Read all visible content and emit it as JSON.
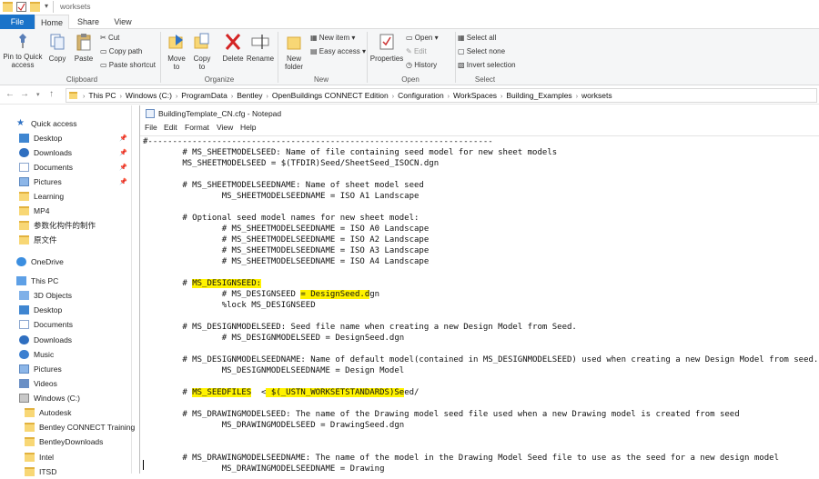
{
  "window": {
    "title": "worksets"
  },
  "tabs": {
    "file": "File",
    "home": "Home",
    "share": "Share",
    "view": "View"
  },
  "ribbon": {
    "clipboard": {
      "pin": "Pin to Quick access",
      "copy": "Copy",
      "paste": "Paste",
      "cut": "Cut",
      "copy_path": "Copy path",
      "paste_shortcut": "Paste shortcut",
      "label": "Clipboard"
    },
    "organize": {
      "move": "Move to",
      "copy_to": "Copy to",
      "delete": "Delete",
      "rename": "Rename",
      "label": "Organize"
    },
    "new": {
      "new_folder": "New folder",
      "new_item": "New item",
      "easy_access": "Easy access",
      "label": "New"
    },
    "open": {
      "properties": "Properties",
      "open": "Open",
      "edit": "Edit",
      "history": "History",
      "label": "Open"
    },
    "select": {
      "select_all": "Select all",
      "select_none": "Select none",
      "invert": "Invert selection",
      "label": "Select"
    }
  },
  "address": {
    "crumbs": [
      "This PC",
      "Windows (C:)",
      "ProgramData",
      "Bentley",
      "OpenBuildings CONNECT Edition",
      "Configuration",
      "WorkSpaces",
      "Building_Examples",
      "worksets"
    ]
  },
  "nav": {
    "quick_access": "Quick access",
    "quick": [
      {
        "label": "Desktop",
        "pinned": true
      },
      {
        "label": "Downloads",
        "pinned": true
      },
      {
        "label": "Documents",
        "pinned": true
      },
      {
        "label": "Pictures",
        "pinned": true
      },
      {
        "label": "Learning",
        "pinned": false
      },
      {
        "label": "MP4",
        "pinned": false
      },
      {
        "label": "参数化构件的制作",
        "pinned": false
      },
      {
        "label": "原文件",
        "pinned": false
      }
    ],
    "onedrive": "OneDrive",
    "this_pc": "This PC",
    "pc_items": [
      "3D Objects",
      "Desktop",
      "Documents",
      "Downloads",
      "Music",
      "Pictures",
      "Videos",
      "Windows (C:)"
    ],
    "drive_items": [
      "Autodesk",
      "Bentley CONNECT Training",
      "BentleyDownloads",
      "Intel",
      "ITSD"
    ]
  },
  "notepad": {
    "title": "BuildingTemplate_CN.cfg - Notepad",
    "menu": [
      "File",
      "Edit",
      "Format",
      "View",
      "Help"
    ],
    "lines": [
      "#----------------------------------------------------------------------",
      "        # MS_SHEETMODELSEED: Name of file containing seed model for new sheet models",
      "        MS_SHEETMODELSEED = $(TFDIR)Seed/SheetSeed_ISOCN.dgn",
      "",
      "        # MS_SHEETMODELSEEDNAME: Name of sheet model seed",
      "                MS_SHEETMODELSEEDNAME = ISO A1 Landscape",
      "",
      "        # Optional seed model names for new sheet model:",
      "                # MS_SHEETMODELSEEDNAME = ISO A0 Landscape",
      "                # MS_SHEETMODELSEEDNAME = ISO A2 Landscape",
      "                # MS_SHEETMODELSEEDNAME = ISO A3 Landscape",
      "                # MS_SHEETMODELSEEDNAME = ISO A4 Landscape",
      "",
      "        # MS_DESIGNSEED:",
      "                # MS_DESIGNSEED = DesignSeed.dgn",
      "                %lock MS_DESIGNSEED",
      "",
      "        # MS_DESIGNMODELSEED: Seed file name when creating a new Design Model from Seed.",
      "                # MS_DESIGNMODELSEED = DesignSeed.dgn",
      "",
      "        # MS_DESIGNMODELSEEDNAME: Name of default model(contained in MS_DESIGNMODELSEED) used when creating a new Design Model from seed.",
      "                MS_DESIGNMODELSEEDNAME = Design Model",
      "",
      "        # MS_SEEDFILES  < $(_USTN_WORKSETSTANDARDS)Seed/",
      "",
      "        # MS_DRAWINGMODELSEED: The name of the Drawing model seed file used when a new Drawing model is created from seed",
      "                MS_DRAWINGMODELSEED = DrawingSeed.dgn",
      "",
      "",
      "        # MS_DRAWINGMODELSEEDNAME: The name of the model in the Drawing Model Seed file to use as the seed for a new design model",
      "                MS_DRAWINGMODELSEEDNAME = Drawing"
    ],
    "highlights": [
      {
        "line": 13,
        "start": 10,
        "end": 24
      },
      {
        "line": 14,
        "start": 32,
        "end": 46
      },
      {
        "line": 23,
        "start": 10,
        "end": 22
      },
      {
        "line": 23,
        "start": 25,
        "end": 53
      }
    ]
  }
}
